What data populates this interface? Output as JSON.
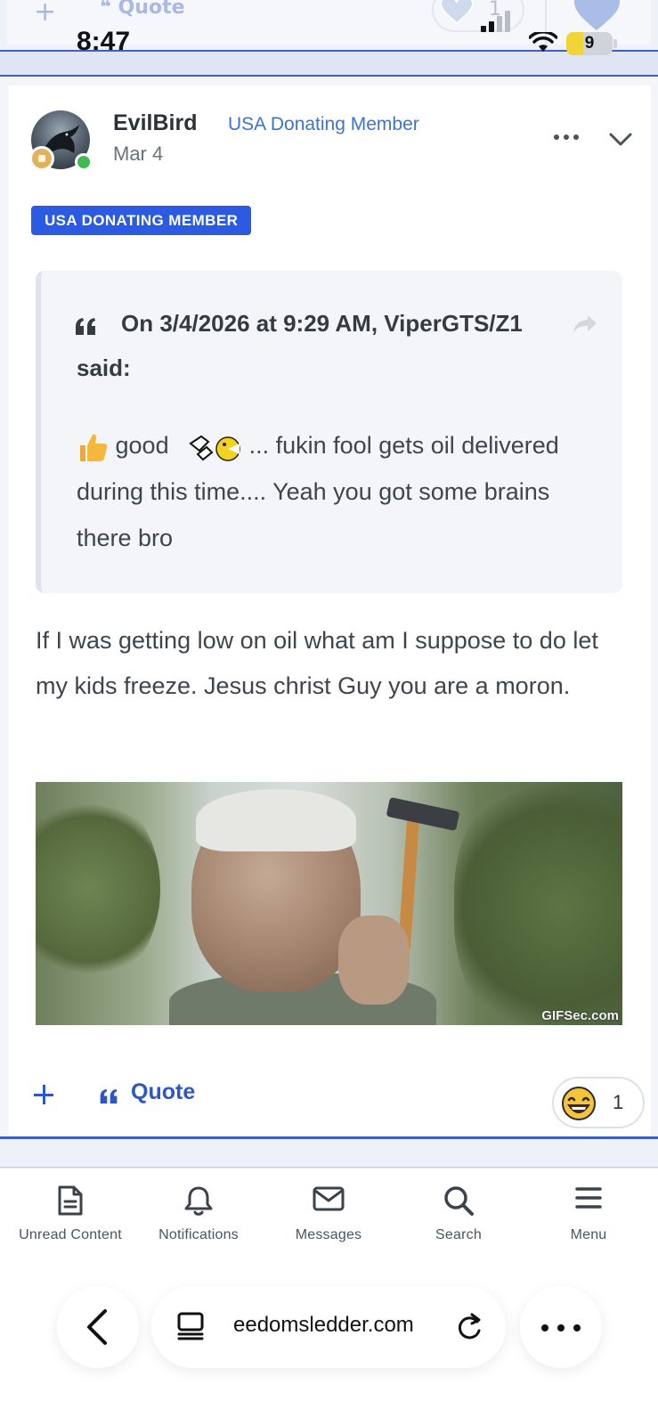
{
  "status_bar": {
    "time": "8:47",
    "battery": "9"
  },
  "previous_post": {
    "quote_label": "Quote",
    "reaction_count": "1"
  },
  "post": {
    "author": "EvilBird",
    "group_title": "USA Donating Member",
    "date": "Mar 4",
    "badge": "USA DONATING MEMBER",
    "quote": {
      "header": "On 3/4/2026 at 9:29 AM, ViperGTS/Z1",
      "said": "said:",
      "text_before": "good",
      "text_after": "... fukin fool gets oil delivered during this time.... Yeah you got some brains there bro"
    },
    "body": "If I was getting low on oil what am I suppose to do let my kids freeze. Jesus christ Guy you are a moron.",
    "image_watermark": "GIFSec.com",
    "footer": {
      "quote_label": "Quote",
      "reaction_count": "1"
    }
  },
  "bottom_nav": {
    "items": [
      {
        "label": "Unread Content",
        "icon": "document-icon"
      },
      {
        "label": "Notifications",
        "icon": "bell-icon"
      },
      {
        "label": "Messages",
        "icon": "envelope-icon"
      },
      {
        "label": "Search",
        "icon": "search-icon"
      },
      {
        "label": "Menu",
        "icon": "hamburger-icon"
      }
    ]
  },
  "browser": {
    "url": "eedomsledder.com"
  },
  "colors": {
    "accent": "#2d57c8",
    "badge": "#2a5be0",
    "group_title": "#3d74c9",
    "online": "#3fb950"
  }
}
